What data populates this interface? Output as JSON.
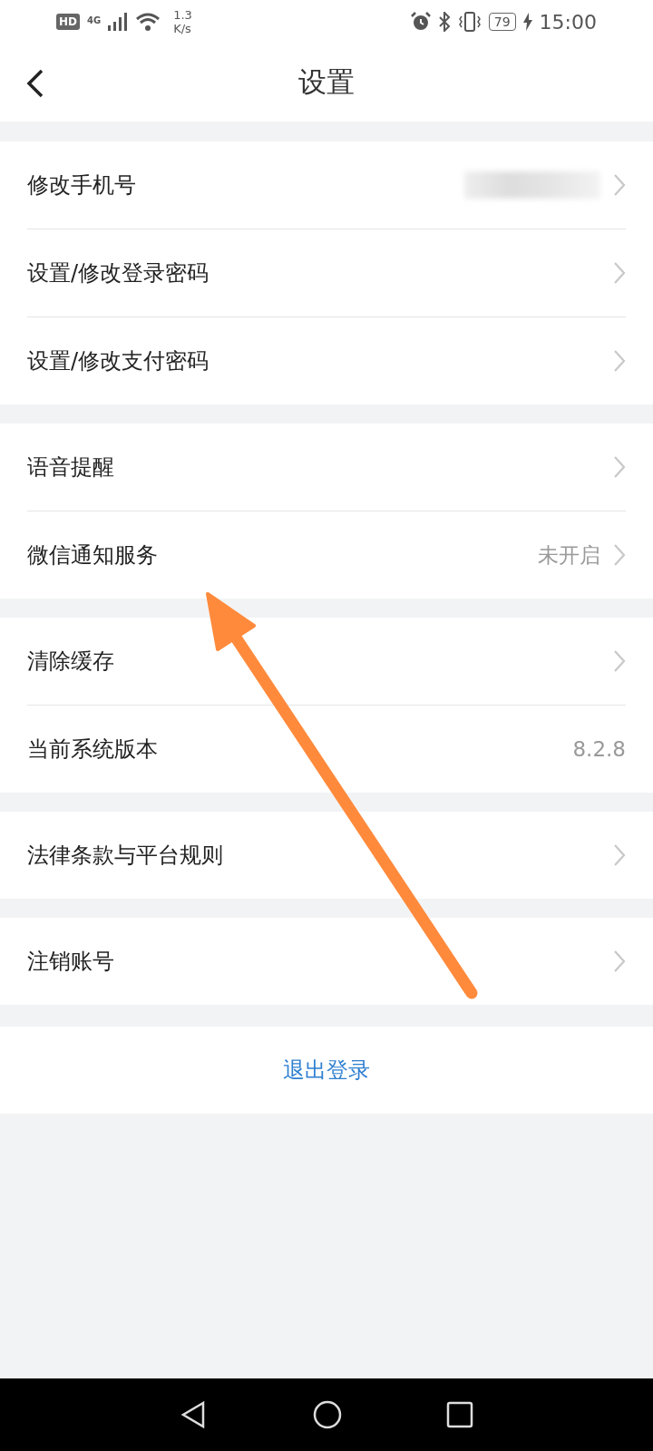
{
  "status_bar": {
    "hd": "HD",
    "network": "4G",
    "speed_value": "1.3",
    "speed_unit": "K/s",
    "battery": "79",
    "time": "15:00"
  },
  "header": {
    "title": "设置"
  },
  "groups": [
    {
      "items": [
        {
          "label": "修改手机号",
          "kind": "redacted"
        },
        {
          "label": "设置/修改登录密码",
          "kind": "link"
        },
        {
          "label": "设置/修改支付密码",
          "kind": "link"
        }
      ]
    },
    {
      "items": [
        {
          "label": "语音提醒",
          "kind": "link"
        },
        {
          "label": "微信通知服务",
          "kind": "link",
          "value": "未开启"
        }
      ]
    },
    {
      "items": [
        {
          "label": "清除缓存",
          "kind": "link"
        },
        {
          "label": "当前系统版本",
          "kind": "info",
          "value": "8.2.8"
        }
      ]
    },
    {
      "items": [
        {
          "label": "法律条款与平台规则",
          "kind": "link"
        }
      ]
    },
    {
      "items": [
        {
          "label": "注销账号",
          "kind": "link"
        }
      ]
    }
  ],
  "logout": {
    "label": "退出登录"
  }
}
